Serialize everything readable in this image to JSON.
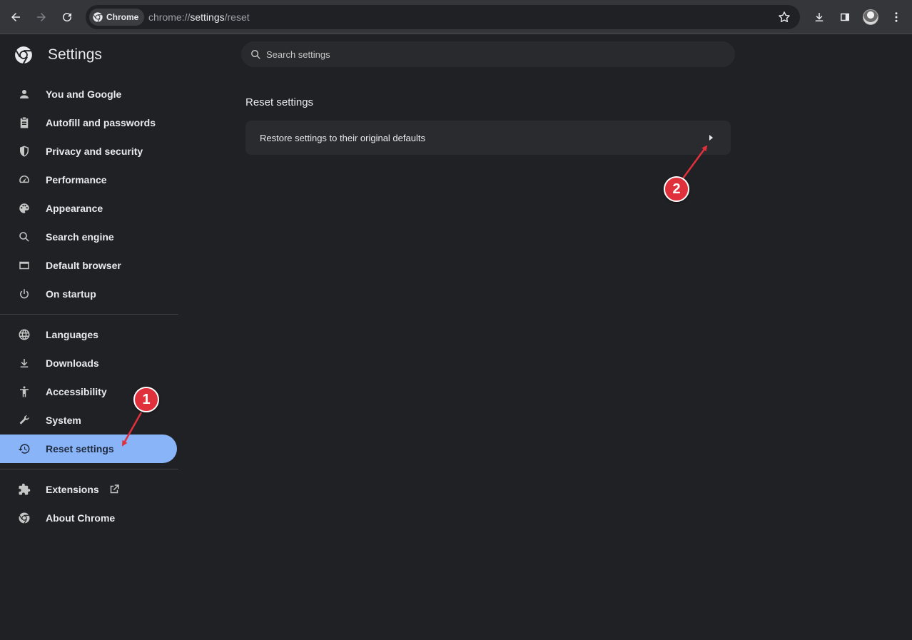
{
  "browser": {
    "chip_label": "Chrome",
    "url_scheme": "chrome://",
    "url_host": "settings",
    "url_path": "/reset"
  },
  "settings": {
    "title": "Settings",
    "search_placeholder": "Search settings"
  },
  "sidebar": {
    "group1": [
      {
        "label": "You and Google",
        "icon": "person-icon"
      },
      {
        "label": "Autofill and passwords",
        "icon": "clipboard-icon"
      },
      {
        "label": "Privacy and security",
        "icon": "shield-icon"
      },
      {
        "label": "Performance",
        "icon": "speedometer-icon"
      },
      {
        "label": "Appearance",
        "icon": "palette-icon"
      },
      {
        "label": "Search engine",
        "icon": "search-icon"
      },
      {
        "label": "Default browser",
        "icon": "browser-window-icon"
      },
      {
        "label": "On startup",
        "icon": "power-icon"
      }
    ],
    "group2": [
      {
        "label": "Languages",
        "icon": "globe-icon"
      },
      {
        "label": "Downloads",
        "icon": "download-icon"
      },
      {
        "label": "Accessibility",
        "icon": "accessibility-icon"
      },
      {
        "label": "System",
        "icon": "wrench-icon"
      },
      {
        "label": "Reset settings",
        "icon": "restore-icon",
        "active": true
      }
    ],
    "group3": [
      {
        "label": "Extensions",
        "icon": "puzzle-icon"
      },
      {
        "label": "About Chrome",
        "icon": "chrome-icon"
      }
    ]
  },
  "main": {
    "section_title": "Reset settings",
    "restore_row_label": "Restore settings to their original defaults"
  },
  "annotations": [
    {
      "number": "1"
    },
    {
      "number": "2"
    }
  ],
  "colors": {
    "accent": "#8ab4f8",
    "background": "#202124",
    "annotation": "#e0303c"
  }
}
